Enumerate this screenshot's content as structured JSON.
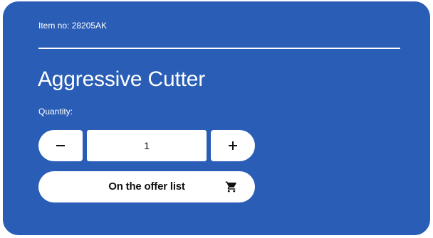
{
  "product": {
    "item_no_text": "Item no: 28205AK",
    "title": "Aggressive Cutter"
  },
  "quantity": {
    "label": "Quantity:",
    "value": "1",
    "decrement_symbol": "−",
    "increment_symbol": "+",
    "decrement_icon": "minus-icon",
    "increment_icon": "plus-icon"
  },
  "offer_button": {
    "label": "On the offer list",
    "icon": "cart-icon"
  },
  "colors": {
    "card_background": "#2a5db5",
    "button_background": "#ffffff",
    "text_on_card": "#ffffff",
    "text_on_button": "#111111"
  }
}
